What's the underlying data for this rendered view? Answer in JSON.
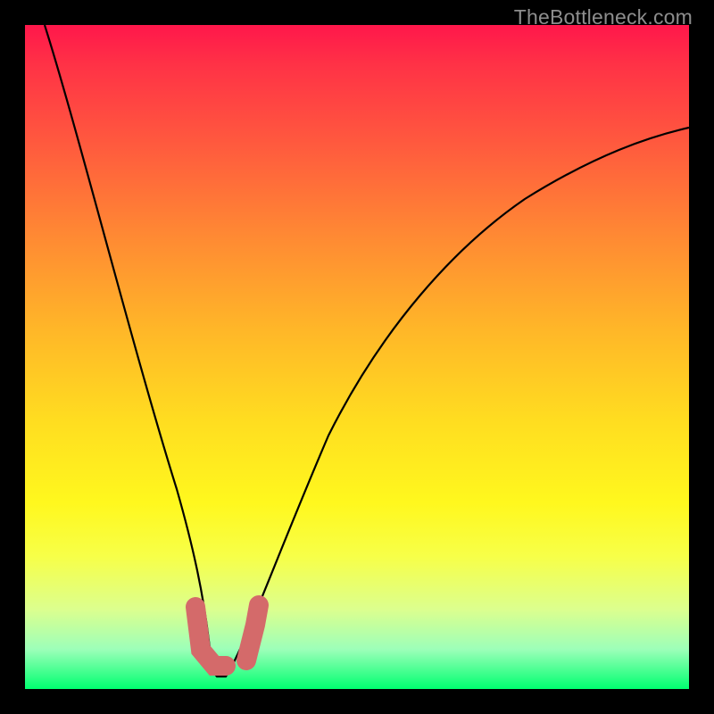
{
  "watermark": "TheBottleneck.com",
  "chart_data": {
    "type": "line",
    "title": "",
    "xlabel": "",
    "ylabel": "",
    "xlim": [
      0,
      100
    ],
    "ylim": [
      0,
      100
    ],
    "series": [
      {
        "name": "curve",
        "x": [
          3,
          6,
          10,
          14,
          18,
          22,
          24,
          26,
          27,
          28,
          30,
          32,
          35,
          40,
          46,
          54,
          62,
          72,
          84,
          100
        ],
        "y": [
          100,
          90,
          77,
          63,
          48,
          30,
          18,
          8,
          4,
          4,
          4,
          7,
          16,
          30,
          43,
          55,
          64,
          71,
          77,
          82
        ]
      }
    ],
    "markers": [
      {
        "name": "left-marker",
        "points": [
          [
            25,
            13
          ],
          [
            25,
            8
          ],
          [
            26,
            5
          ],
          [
            27,
            4
          ],
          [
            28,
            4
          ]
        ],
        "color": "#d46a6a"
      },
      {
        "name": "right-marker",
        "points": [
          [
            30,
            4
          ],
          [
            32,
            8
          ],
          [
            33,
            12
          ]
        ],
        "color": "#d46a6a"
      }
    ],
    "background_gradient": {
      "top": "#ff174b",
      "bottom": "#00ff70"
    }
  }
}
